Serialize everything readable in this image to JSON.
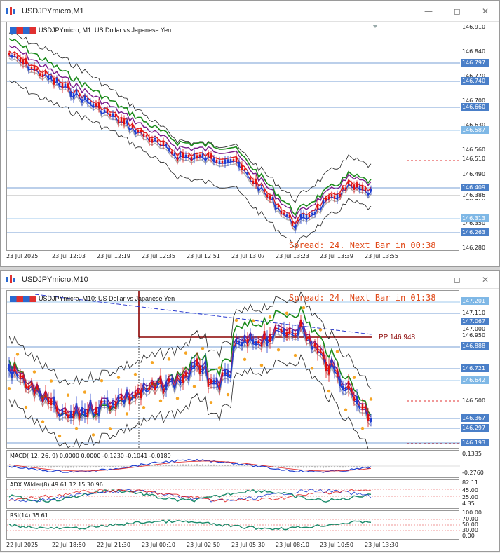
{
  "window1": {
    "title": "USDJPYmicro,M1",
    "chart_title": "USDJPYmicro, M1:  US Dollar vs Japanese Yen",
    "status": "Spread: 24. Next Bar in 00:38",
    "price_labels": [
      "146.910",
      "146.840",
      "146.770",
      "146.700",
      "146.630",
      "146.560",
      "146.490",
      "146.420",
      "146.350",
      "146.280"
    ],
    "price_tags": [
      {
        "text": "146.797",
        "color": "#4a7fc8"
      },
      {
        "text": "146.740",
        "color": "#4a7fc8"
      },
      {
        "text": "146.660",
        "color": "#4a7fc8"
      },
      {
        "text": "146.587",
        "color": "#7fb8e6"
      },
      {
        "text": "146.510",
        "color": "#ffffff",
        "textcolor": "#222"
      },
      {
        "text": "146.409",
        "color": "#4a7fc8"
      },
      {
        "text": "146.386",
        "color": "#ffffff",
        "textcolor": "#222"
      },
      {
        "text": "146.313",
        "color": "#7fb8e6"
      },
      {
        "text": "146.263",
        "color": "#4a7fc8"
      }
    ],
    "time_labels": [
      "23 Jul 2025",
      "23 Jul 12:03",
      "23 Jul 12:19",
      "23 Jul 12:35",
      "23 Jul 12:51",
      "23 Jul 13:07",
      "23 Jul 13:23",
      "23 Jul 13:39",
      "23 Jul 13:55"
    ]
  },
  "window2": {
    "title": "USDJPYmicro,M10",
    "chart_title": "USDJPYmicro, M10:  US Dollar vs Japanese Yen",
    "status": "Spread: 24. Next Bar in 01:38",
    "pivot": "PP 146.948",
    "price_tags": [
      {
        "text": "147.201",
        "color": "#7fb8e6"
      },
      {
        "text": "147.110",
        "color": "#ffffff",
        "textcolor": "#222"
      },
      {
        "text": "147.067",
        "color": "#4a7fc8"
      },
      {
        "text": "147.000",
        "color": "#ffffff",
        "textcolor": "#222"
      },
      {
        "text": "146.950",
        "color": "#ffffff",
        "textcolor": "#222"
      },
      {
        "text": "146.888",
        "color": "#4a7fc8"
      },
      {
        "text": "146.721",
        "color": "#4a7fc8"
      },
      {
        "text": "146.642",
        "color": "#7fb8e6"
      },
      {
        "text": "146.500",
        "color": "#ffffff",
        "textcolor": "#222"
      },
      {
        "text": "146.367",
        "color": "#4a7fc8"
      },
      {
        "text": "146.297",
        "color": "#4a7fc8"
      },
      {
        "text": "146.193",
        "color": "#4a7fc8"
      }
    ],
    "macd": {
      "label": "MACD( 12, 26, 9) 0.0000 0.0000 -0.1230 -0.1041 -0.0189",
      "scale_top": "0.1335",
      "scale_bottom": "-0.2760"
    },
    "adx": {
      "label": "ADX Wilder(8) 49.61 12.15 30.96",
      "scale": [
        "82.11",
        "45.00",
        "25.00",
        "4.35"
      ]
    },
    "rsi": {
      "label": "RSI(14) 35.61",
      "scale": [
        "100.00",
        "70.00",
        "50.00",
        "30.00",
        "0.00"
      ]
    },
    "time_labels": [
      "22 Jul 2025",
      "22 Jul 18:50",
      "22 Jul 21:30",
      "23 Jul 00:10",
      "23 Jul 02:50",
      "23 Jul 05:30",
      "23 Jul 08:10",
      "23 Jul 10:50",
      "23 Jul 13:30"
    ]
  },
  "colors": {
    "bull": "#1f3fd0",
    "bear": "#e01010",
    "ma_green": "#1a8a1a",
    "ma_purple": "#7a1a8a",
    "ma_red": "#e02020",
    "ma_grey": "#b0b0b0"
  }
}
